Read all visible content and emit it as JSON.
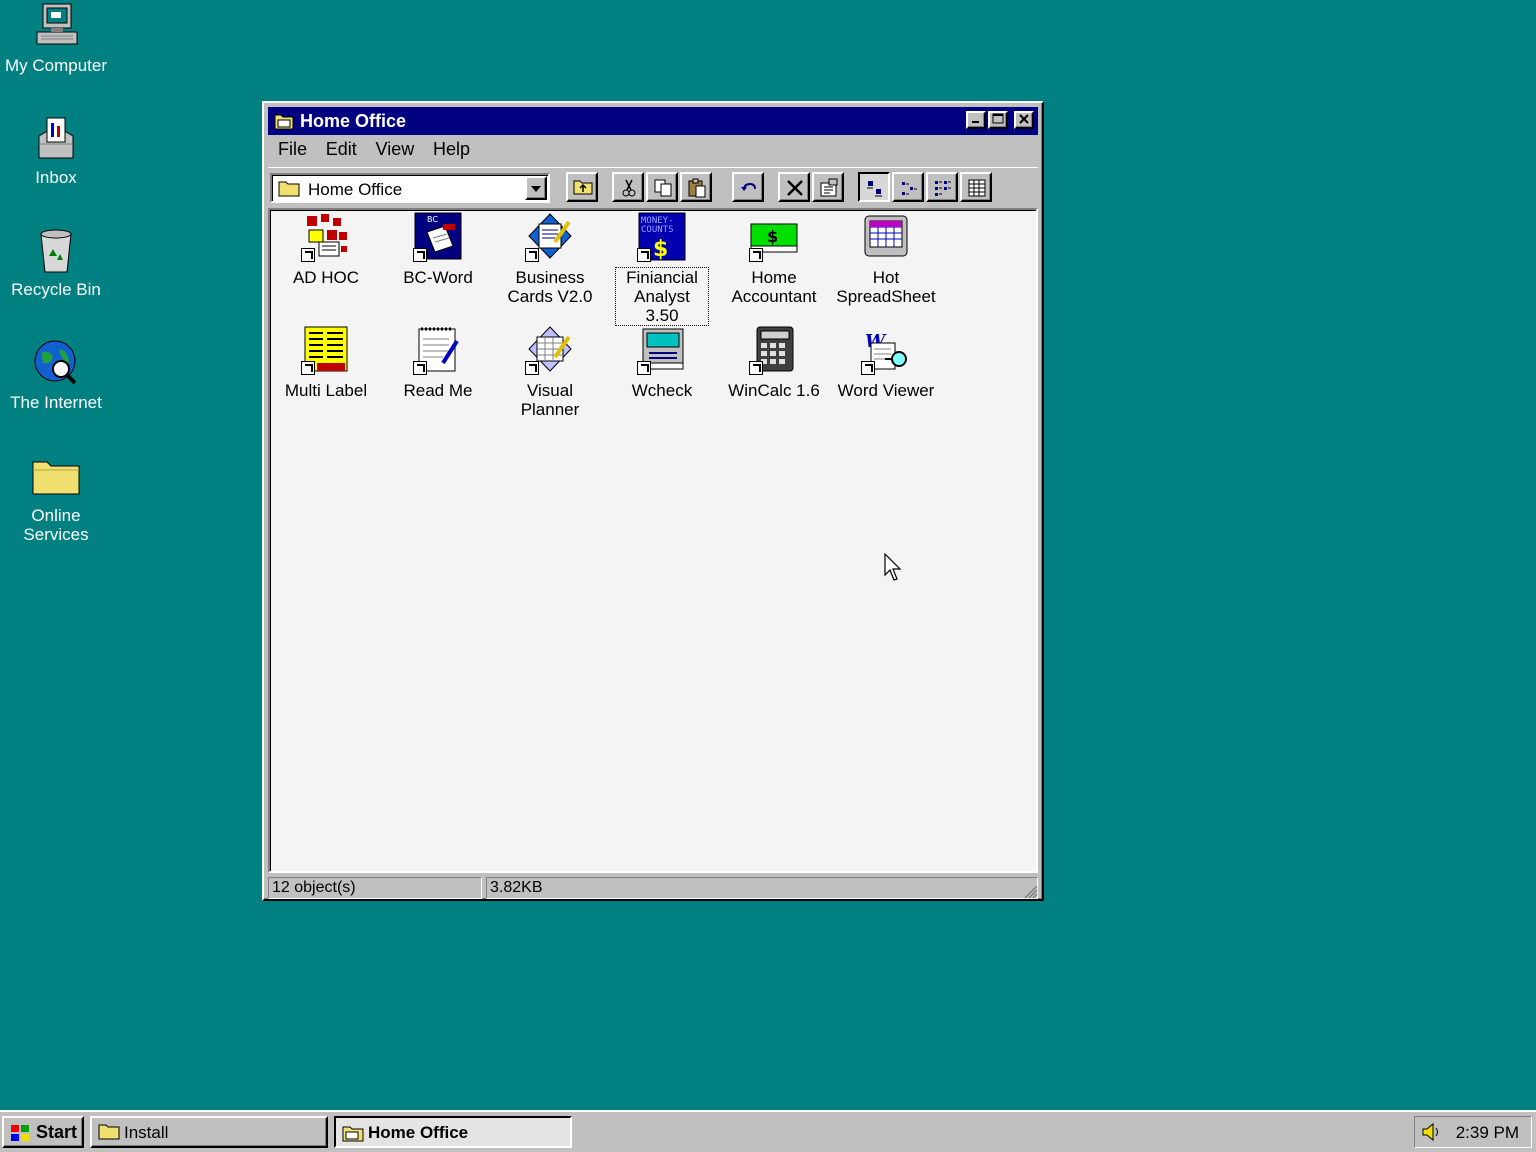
{
  "desktop": {
    "icons": [
      {
        "label": "My Computer",
        "icon": "computer-icon"
      },
      {
        "label": "Inbox",
        "icon": "inbox-icon"
      },
      {
        "label": "Recycle Bin",
        "icon": "recycle-bin-icon"
      },
      {
        "label": "The Internet",
        "icon": "internet-icon"
      },
      {
        "label": "Online Services",
        "icon": "folder-icon"
      }
    ]
  },
  "window": {
    "title": "Home Office",
    "menu": {
      "file": "File",
      "edit": "Edit",
      "view": "View",
      "help": "Help"
    },
    "address": "Home Office",
    "items": [
      {
        "label": "AD HOC",
        "icon": "adhoc-icon"
      },
      {
        "label": "BC-Word",
        "icon": "bcword-icon"
      },
      {
        "label": "Business Cards V2.0",
        "icon": "business-cards-icon"
      },
      {
        "label": "Finiancial Analyst 3.50",
        "icon": "money-counts-icon"
      },
      {
        "label": "Home Accountant",
        "icon": "dollar-bill-icon"
      },
      {
        "label": "Hot SpreadSheet",
        "icon": "spreadsheet-icon"
      },
      {
        "label": "Multi Label",
        "icon": "labels-icon"
      },
      {
        "label": "Read Me",
        "icon": "notepad-icon"
      },
      {
        "label": "Visual Planner",
        "icon": "planner-icon"
      },
      {
        "label": "Wcheck",
        "icon": "check-icon"
      },
      {
        "label": "WinCalc 1.6",
        "icon": "calculator-icon"
      },
      {
        "label": "Word Viewer",
        "icon": "word-viewer-icon"
      }
    ],
    "status": {
      "objects": "12 object(s)",
      "size": "3.82KB"
    }
  },
  "taskbar": {
    "start": "Start",
    "tasks": [
      {
        "label": "Install",
        "active": false
      },
      {
        "label": "Home Office",
        "active": true
      }
    ],
    "clock": "2:39 PM"
  },
  "colors": {
    "desktop": "#008080",
    "titlebar": "#000080",
    "face": "#c0c0c0"
  }
}
